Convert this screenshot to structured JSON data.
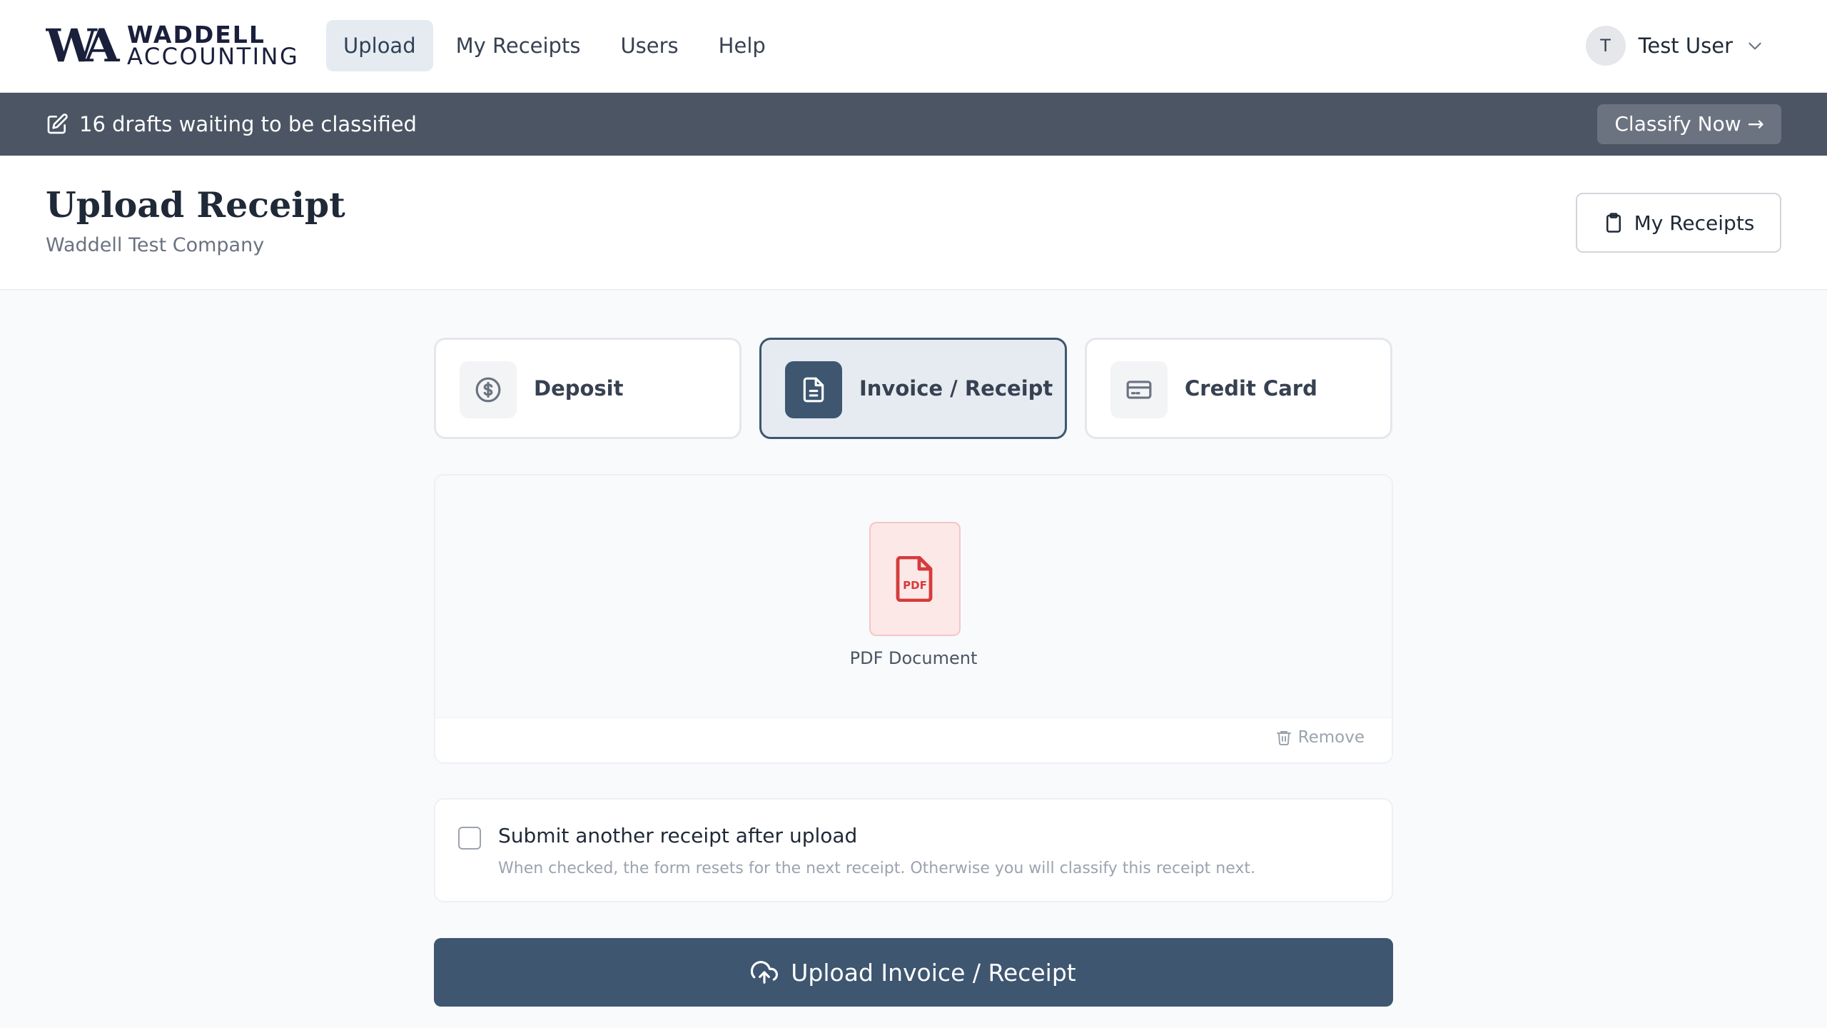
{
  "header": {
    "logo": {
      "monogram": "WA",
      "line1": "WADDELL",
      "line2": "ACCOUNTING"
    },
    "nav": [
      {
        "label": "Upload",
        "active": true
      },
      {
        "label": "My Receipts",
        "active": false
      },
      {
        "label": "Users",
        "active": false
      },
      {
        "label": "Help",
        "active": false
      }
    ],
    "user": {
      "initial": "T",
      "name": "Test User",
      "icon": "chevron-down-icon"
    }
  },
  "banner": {
    "icon": "edit-icon",
    "text": "16 drafts waiting to be classified",
    "action_label": "Classify Now →"
  },
  "page": {
    "title": "Upload Receipt",
    "subtitle": "Waddell Test Company",
    "my_receipts_label": "My Receipts",
    "my_receipts_icon": "clipboard-icon"
  },
  "types": [
    {
      "label": "Deposit",
      "icon": "dollar-circle-icon",
      "active": false
    },
    {
      "label": "Invoice / Receipt",
      "icon": "document-icon",
      "active": true
    },
    {
      "label": "Credit Card",
      "icon": "credit-card-icon",
      "active": false
    }
  ],
  "preview": {
    "file_type_label": "PDF Document",
    "file_badge": "PDF",
    "remove_label": "Remove"
  },
  "options": {
    "checked": false,
    "label": "Submit another receipt after upload",
    "hint": "When checked, the form resets for the next receipt. Otherwise you will classify this receipt next."
  },
  "submit": {
    "label": "Upload Invoice / Receipt",
    "icon": "upload-cloud-icon"
  },
  "colors": {
    "primary": "#3e5670",
    "banner": "#4b5563",
    "active_bg": "#e5ebf1",
    "pdf_red": "#d63b3b",
    "page_bg": "#f8fafc"
  }
}
